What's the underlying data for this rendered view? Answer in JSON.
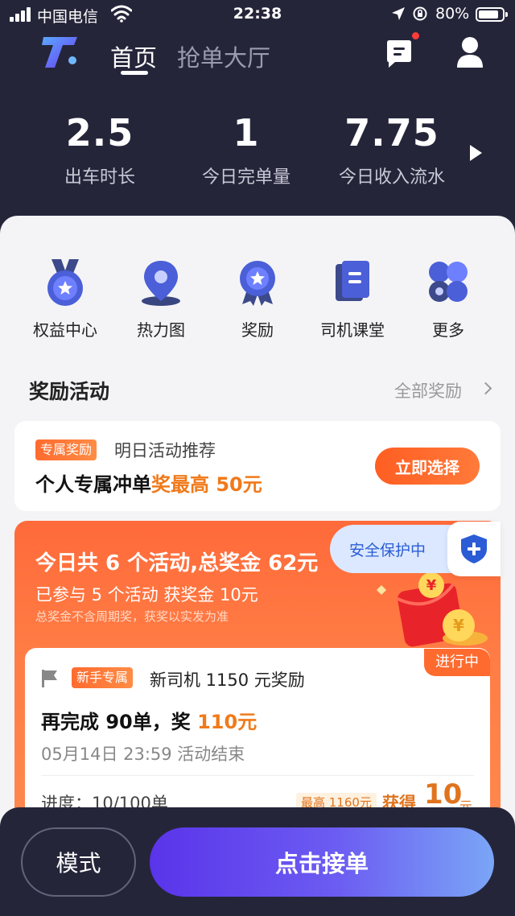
{
  "status_bar": {
    "carrier": "中国电信",
    "time": "22:38",
    "battery": "80%"
  },
  "nav": {
    "home": "首页",
    "grab_hall": "抢单大厅"
  },
  "stats": [
    {
      "value": "2.5",
      "label": "出车时长"
    },
    {
      "value": "1",
      "label": "今日完单量"
    },
    {
      "value": "7.75",
      "label": "今日收入流水"
    }
  ],
  "quick_menu": [
    {
      "label": "权益中心",
      "icon": "medal-icon"
    },
    {
      "label": "热力图",
      "icon": "location-pin-icon"
    },
    {
      "label": "奖励",
      "icon": "reward-badge-icon"
    },
    {
      "label": "司机课堂",
      "icon": "book-icon"
    },
    {
      "label": "更多",
      "icon": "more-grid-icon"
    }
  ],
  "rewards": {
    "title": "奖励活动",
    "all_link": "全部奖励"
  },
  "exclusive": {
    "tag": "专属奖励",
    "subtitle": "明日活动推荐",
    "title_prefix": "个人专属冲单",
    "title_highlight": "奖最高 50元",
    "button": "立即选择"
  },
  "activity": {
    "title": "今日共 6 个活动,总奖金 62元",
    "joined": "已参与 5 个活动 获奖金 10元",
    "note": "总奖金不含周期奖，获奖以实发为准",
    "safety": "安全保护中"
  },
  "task": {
    "status": "进行中",
    "tag": "新手专属",
    "name": "新司机 1150 元奖励",
    "main_prefix": "再完成 90单，奖 ",
    "main_amount": "110元",
    "deadline": "05月14日 23:59 活动结束",
    "progress": "进度：10/100单",
    "max_badge": "最高 1160元",
    "earned_label": "获得",
    "earned_amount": "10",
    "earned_unit": "元"
  },
  "bottom": {
    "mode": "模式",
    "accept": "点击接单"
  },
  "colors": {
    "dark_bg": "#25253a",
    "accent_orange": "#ff6b2f",
    "accent_purple": "#5a34ea",
    "safety_blue": "#2b5cd6"
  }
}
